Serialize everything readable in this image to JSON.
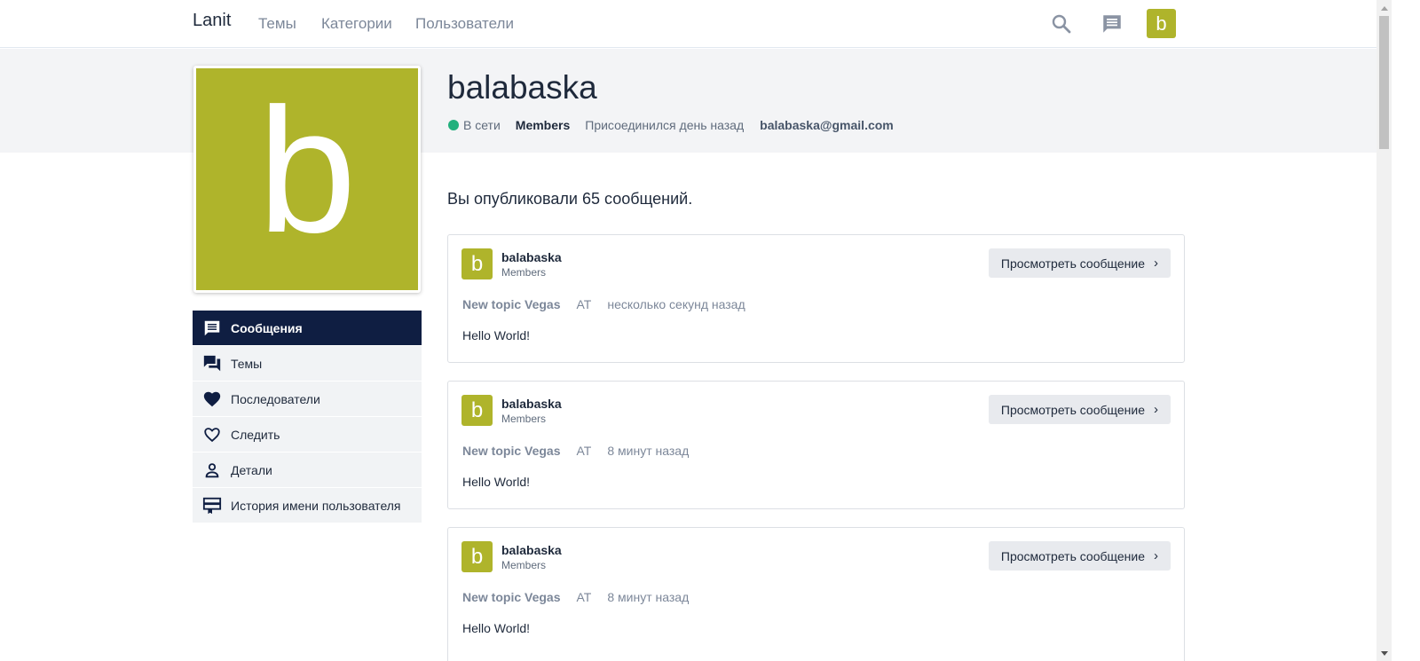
{
  "nav": {
    "brand": "Lanit",
    "links": [
      "Темы",
      "Категории",
      "Пользователи"
    ],
    "avatar_letter": "b",
    "icons": [
      "search-icon",
      "chat-icon"
    ]
  },
  "profile": {
    "avatar_letter": "b",
    "username": "balabaska",
    "status": "В сети",
    "group": "Members",
    "joined": "Присоединился день назад",
    "email": "balabaska@gmail.com",
    "avatar_color": "#afb42b",
    "status_color": "#22b07d"
  },
  "menu": {
    "items": [
      {
        "label": "Сообщения",
        "icon": "chat-icon",
        "active": true
      },
      {
        "label": "Темы",
        "icon": "forum-icon"
      },
      {
        "label": "Последователи",
        "icon": "heart-icon"
      },
      {
        "label": "Следить",
        "icon": "heart-outline-icon"
      },
      {
        "label": "Детали",
        "icon": "person-icon"
      },
      {
        "label": "История имени пользователя",
        "icon": "card-icon"
      }
    ]
  },
  "content": {
    "summary": "Вы опубликовали 65 сообщений.",
    "posts": [
      {
        "avatar_letter": "b",
        "user": "balabaska",
        "group": "Members",
        "view_label": "Просмотреть сообщение",
        "topic": "New topic Vegas",
        "at": "AT",
        "time": "несколько секунд назад",
        "body": "Hello World!"
      },
      {
        "avatar_letter": "b",
        "user": "balabaska",
        "group": "Members",
        "view_label": "Просмотреть сообщение",
        "topic": "New topic Vegas",
        "at": "AT",
        "time": "8 минут назад",
        "body": "Hello World!"
      },
      {
        "avatar_letter": "b",
        "user": "balabaska",
        "group": "Members",
        "view_label": "Просмотреть сообщение",
        "topic": "New topic Vegas",
        "at": "AT",
        "time": "8 минут назад",
        "body": "Hello World!"
      }
    ]
  }
}
